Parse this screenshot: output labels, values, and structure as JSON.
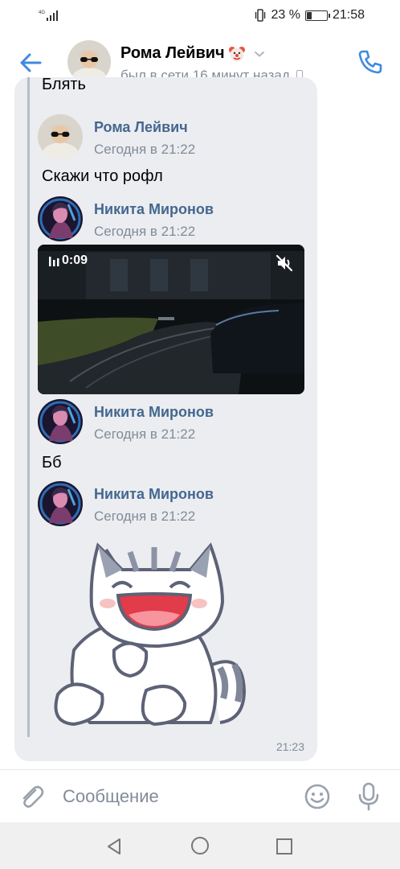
{
  "status_bar": {
    "network": "4G",
    "battery_percent": "23 %",
    "time": "21:58"
  },
  "header": {
    "contact_name": "Рома Лейвич",
    "name_emoji": "clown-face-icon",
    "last_seen": "был в сети 16 минут назад"
  },
  "chat": {
    "cut_off_text": "Блять",
    "messages": [
      {
        "author": "Рома Лейвич",
        "time": "Сегодня в 21:22",
        "text": "Скажи что рофл"
      },
      {
        "author": "Никита Миронов",
        "time": "Сегодня в 21:22",
        "video_duration": "0:09"
      },
      {
        "author": "Никита Миронов",
        "time": "Сегодня в 21:22",
        "text": "Бб"
      },
      {
        "author": "Никита Миронов",
        "time": "Сегодня в 21:22",
        "sticker": "laughing-cat-sticker"
      }
    ],
    "bubble_time": "21:23"
  },
  "composer": {
    "placeholder": "Сообщение"
  },
  "colors": {
    "accent": "#3f8ae0",
    "name_link": "#45678f",
    "secondary_text": "#818c99",
    "bubble_bg": "#ebedf0"
  }
}
